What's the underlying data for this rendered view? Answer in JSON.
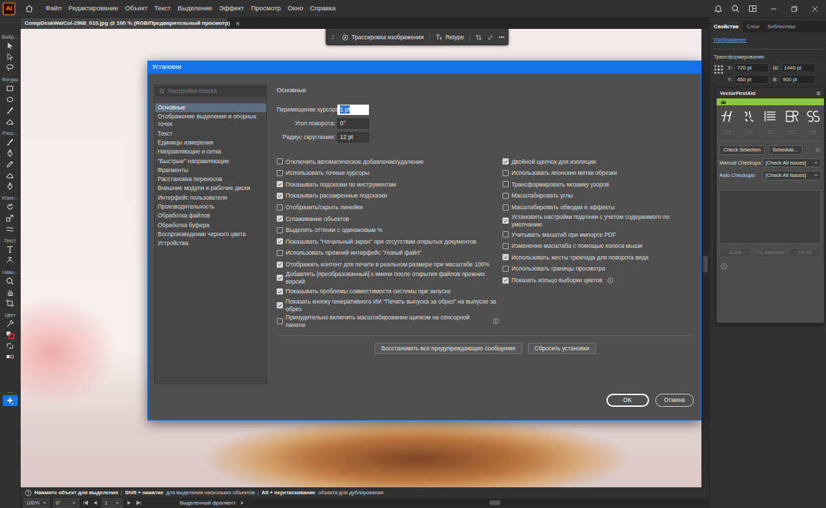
{
  "menu_bar": {
    "app_logo": "Ai",
    "items": [
      "Файл",
      "Редактирование",
      "Объект",
      "Текст",
      "Выделение",
      "Эффект",
      "Просмотр",
      "Окно",
      "Справка"
    ]
  },
  "document_tab": {
    "title": "CompDeskWalCol-2968_010.jpg @ 100 % (RGB/Предварительный просмотр)",
    "close": "×"
  },
  "toolbar": {
    "groups": [
      {
        "label": "Выбр...",
        "tools": [
          {
            "selected": false
          },
          {
            "selected": false
          },
          {
            "selected": false
          }
        ]
      },
      {
        "label": "Фигуры",
        "tools": [
          {
            "selected": false
          },
          {
            "selected": false
          },
          {
            "selected": false
          },
          {
            "selected": false
          }
        ]
      },
      {
        "label": "Рисо...",
        "tools": [
          {
            "selected": false
          },
          {
            "selected": false
          },
          {
            "selected": false
          },
          {
            "selected": false
          },
          {
            "selected": false
          }
        ]
      },
      {
        "label": "Изме...",
        "tools": [
          {
            "selected": false
          },
          {
            "selected": false
          },
          {
            "selected": false
          }
        ]
      },
      {
        "label": "Текст",
        "tools": [
          {
            "selected": false
          },
          {
            "selected": false
          }
        ]
      },
      {
        "label": "Нави...",
        "tools": [
          {
            "selected": false
          },
          {
            "selected": false
          },
          {
            "selected": false
          }
        ]
      },
      {
        "label": "Цвет",
        "tools": [
          {
            "selected": false
          },
          {
            "selected": false
          },
          {
            "selected": false
          },
          {
            "selected": false
          }
        ]
      }
    ],
    "more": "...",
    "extra_tools": [
      {
        "selected": true
      }
    ]
  },
  "context_bar": {
    "items": [
      "Трассировка изображения",
      "Retype"
    ],
    "more": "•••"
  },
  "dialog": {
    "title": "Установки",
    "search": {
      "placeholder": "Настройки поиска"
    },
    "sections": [
      {
        "label": "Основные",
        "selected": true
      },
      {
        "label": "Отображение выделения и опорных точек",
        "selected": false
      },
      {
        "label": "Текст",
        "selected": false
      },
      {
        "label": "Единицы измерения",
        "selected": false
      },
      {
        "label": "Направляющие и сетка",
        "selected": false
      },
      {
        "label": "\"Быстрые\" направляющие",
        "selected": false
      },
      {
        "label": "Фрагменты",
        "selected": false
      },
      {
        "label": "Расстановка переносов",
        "selected": false
      },
      {
        "label": "Внешние модули и рабочие диски",
        "selected": false
      },
      {
        "label": "Интерфейс пользователя",
        "selected": false
      },
      {
        "label": "Производительность",
        "selected": false
      },
      {
        "label": "Обработка файлов",
        "selected": false
      },
      {
        "label": "Обработка буфера",
        "selected": false
      },
      {
        "label": "Воспроизведение черного цвета",
        "selected": false
      },
      {
        "label": "Устройства",
        "selected": false
      }
    ],
    "heading": "Основные",
    "fields": [
      {
        "label": "Перемещение курсора:",
        "value": "1 pt",
        "focused": true
      },
      {
        "label": "Угол поворота:",
        "value": "0°",
        "focused": false
      },
      {
        "label": "Радиус скругления:",
        "value": "12 pt",
        "focused": false
      }
    ],
    "checkboxes_left": [
      {
        "label": "Отключить автоматическое добавление/удаление",
        "checked": false,
        "kind": "plain"
      },
      {
        "label": "Использовать точные курсоры",
        "checked": false,
        "kind": "plain"
      },
      {
        "label": "Показывать подсказки по инструментам",
        "checked": true,
        "kind": "plain"
      },
      {
        "label": "Показывать расширенные подсказки",
        "checked": true,
        "kind": "plain"
      },
      {
        "label": "Отобразить/скрыть линейки",
        "checked": false,
        "kind": "plain"
      },
      {
        "label": "Сглаживание объектов",
        "checked": true,
        "kind": "plain"
      },
      {
        "label": "Выделять оттенки с одинаковым %",
        "checked": false,
        "kind": "plain"
      },
      {
        "label": "Показывать \"Начальный экран\" при отсутствии открытых документов",
        "checked": true,
        "kind": "plain"
      },
      {
        "label": "Использовать прежний интерфейс \"Новый файл\"",
        "checked": false,
        "kind": "plain"
      },
      {
        "label": "Отображать контент для печати в реальном размере при масштабе 100%",
        "checked": true,
        "kind": "plain"
      },
      {
        "label": "Добавлять [преобразованный] к имени после открытия файлов прежних версий",
        "checked": true,
        "kind": "plain"
      },
      {
        "label": "Показывать проблемы совместимости системы при запуске",
        "checked": true,
        "kind": "plain"
      },
      {
        "label": "Показать кнопку генеративного ИИ \"Печать выпуска за обрез\" на выпуске за обрез",
        "checked": true,
        "kind": "plain"
      },
      {
        "label": "Принудительно включить масштабирование щипком на сенсорной панели",
        "checked": false,
        "kind": "info"
      }
    ],
    "checkboxes_right": [
      {
        "label": "Двойной щелчок для изоляции",
        "checked": true,
        "kind": "plain"
      },
      {
        "label": "Использовать японские метки обрезки",
        "checked": false,
        "kind": "plain"
      },
      {
        "label": "Трансформировать мозаику узоров",
        "checked": false,
        "kind": "plain"
      },
      {
        "label": "Масштабировать углы",
        "checked": false,
        "kind": "plain"
      },
      {
        "label": "Масштабировать обводки и эффекты",
        "checked": false,
        "kind": "plain"
      },
      {
        "label": "Установить настройки подгонки с учетом содержимого по умолчанию",
        "checked": true,
        "kind": "plain"
      },
      {
        "label": "Учитывать масштаб при импорте PDF",
        "checked": false,
        "kind": "plain"
      },
      {
        "label": "Изменение масштаба с помощью колеса мыши",
        "checked": false,
        "kind": "plain"
      },
      {
        "label": "Использовать жесты трекпада для поворота вида",
        "checked": true,
        "kind": "plain"
      },
      {
        "label": "Использовать границы просмотра",
        "checked": false,
        "kind": "plain"
      },
      {
        "label": "Показать кольцо выборки цветов",
        "checked": true,
        "kind": "info"
      }
    ],
    "actions": [
      "Восстановить все предупреждающие сообщения",
      "Сбросить установки"
    ],
    "buttons": [
      {
        "label": "OK",
        "default": true
      },
      {
        "label": "Отмена",
        "default": false
      }
    ]
  },
  "properties_panel": {
    "tabs": [
      {
        "label": "Свойства",
        "selected": true
      },
      {
        "label": "Слои",
        "selected": false
      },
      {
        "label": "Библиотеки",
        "selected": false
      }
    ],
    "object_type": "Изображение",
    "section": "Трансформирование",
    "fields": [
      {
        "label": "X:",
        "value": "720 pt"
      },
      {
        "label": "Ш:",
        "value": "1440 pt"
      },
      {
        "label": "Y:",
        "value": "450 pt"
      },
      {
        "label": "В:",
        "value": "900 pt"
      }
    ]
  },
  "vector_first_aid": {
    "title": "VectorFirstAid",
    "menu": "≡",
    "buttons": [
      "Check Selection",
      "Schedule..."
    ],
    "checkups": [
      {
        "label": "Manual Checkups:",
        "value": "[Check All Issues]"
      },
      {
        "label": "Auto Checkups:",
        "value": "[Check All Issues]"
      }
    ],
    "fix_buttons": [
      {
        "label": "Solve",
        "disabled": true
      },
      {
        "label": "Fix Selected",
        "disabled": true
      },
      {
        "label": "Fix All",
        "disabled": true
      }
    ]
  },
  "status_bar": {
    "hint": [
      {
        "text": "Нажмите объект для выделения",
        "kind": "key"
      },
      {
        "text": "|",
        "kind": "separator"
      },
      {
        "text": "Shift + нажатие",
        "kind": "key"
      },
      {
        "text": "для выделения нескольких объектов",
        "kind": "plain"
      },
      {
        "text": "|",
        "kind": "separator"
      },
      {
        "text": "Alt + перетаскивание",
        "kind": "key"
      },
      {
        "text": "объекта для дублирования",
        "kind": "plain"
      }
    ],
    "zoom": "100%",
    "rotation": "0°",
    "artboard": "1",
    "selection_mode": "Выделенный фрагмент"
  }
}
